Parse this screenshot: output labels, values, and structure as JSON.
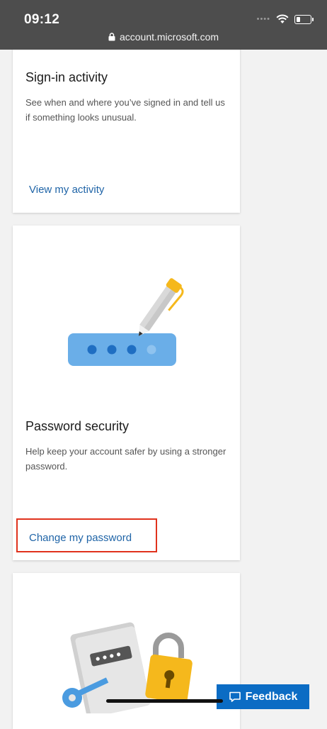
{
  "status_bar": {
    "time": "09:12"
  },
  "browser": {
    "url": "account.microsoft.com"
  },
  "cards": [
    {
      "title": "Sign-in activity",
      "description": "See when and where you’ve signed in and tell us if something looks unusual.",
      "link": "View my activity"
    },
    {
      "title": "Password security",
      "description": "Help keep your account safer by using a stronger password.",
      "link": "Change my password",
      "illustration": "password-pen-illustration"
    },
    {
      "illustration": "device-lock-key-illustration"
    }
  ],
  "feedback": {
    "label": "Feedback",
    "icon": "comment-icon"
  },
  "colors": {
    "link": "#1f64a7",
    "highlight": "#e0321d",
    "feedback_bg": "#0b6cc4",
    "pen_yellow": "#f5b81c",
    "field_blue": "#6aaee8",
    "dot_blue": "#1f6ec2"
  }
}
